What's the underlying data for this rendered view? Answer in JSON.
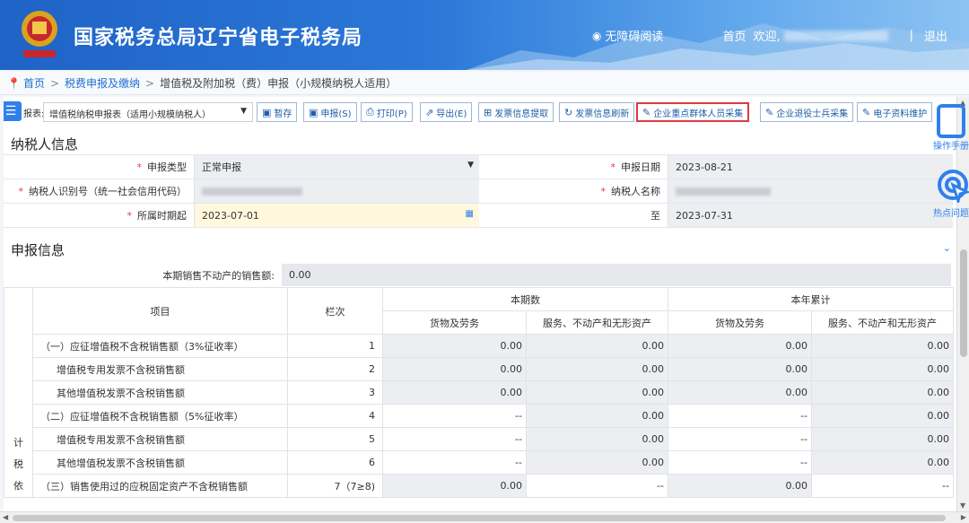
{
  "header": {
    "site_title": "国家税务总局辽宁省电子税务局",
    "accessibility": "无障碍阅读",
    "home": "首页",
    "welcome": "欢迎,",
    "logout": "退出",
    "separator": "|"
  },
  "breadcrumb": {
    "items": [
      "首页",
      "税费申报及缴纳",
      "增值税及附加税（费）申报（小规模纳税人适用）"
    ],
    "arrow": ">"
  },
  "toolbar": {
    "form_label": "报表:",
    "form_select": "增值税纳税申报表（适用小规模纳税人）",
    "buttons": [
      "暂存",
      "申报(S)",
      "打印(P)",
      "导出(E)",
      "发票信息提取",
      "发票信息刷新",
      "企业重点群体人员采集",
      "企业退役士兵采集",
      "电子资料维护"
    ]
  },
  "taxpayer": {
    "title": "纳税人信息",
    "decl_type_label": "申报类型",
    "decl_type_value": "正常申报",
    "decl_date_label": "申报日期",
    "decl_date_value": "2023-08-21",
    "tin_label": "纳税人识别号（统一社会信用代码）",
    "name_label": "纳税人名称",
    "period_label": "所属时期起",
    "period_start": "2023-07-01",
    "period_to_label": "至",
    "period_end": "2023-07-31"
  },
  "declaration": {
    "title": "申报信息",
    "sales_label": "本期销售不动产的销售额:",
    "sales_value": "0.00",
    "headers": {
      "item": "项目",
      "col_no": "栏次",
      "current": "本期数",
      "ytd": "本年累计",
      "goods": "货物及劳务",
      "services": "服务、不动产和无形资产"
    },
    "side_label": [
      "计",
      "税",
      "依"
    ],
    "rows": [
      {
        "item": "（一）应征增值税不含税销售额（3%征收率）",
        "col": "1",
        "c1": "0.00",
        "c2": "0.00",
        "c3": "0.00",
        "c4": "0.00"
      },
      {
        "item": "增值税专用发票不含税销售额",
        "col": "2",
        "c1": "0.00",
        "c2": "0.00",
        "c3": "0.00",
        "c4": "0.00"
      },
      {
        "item": "其他增值税发票不含税销售额",
        "col": "3",
        "c1": "0.00",
        "c2": "0.00",
        "c3": "0.00",
        "c4": "0.00"
      },
      {
        "item": "（二）应征增值税不含税销售额（5%征收率）",
        "col": "4",
        "c1": "--",
        "c2": "0.00",
        "c3": "--",
        "c4": "0.00"
      },
      {
        "item": "增值税专用发票不含税销售额",
        "col": "5",
        "c1": "--",
        "c2": "0.00",
        "c3": "--",
        "c4": "0.00"
      },
      {
        "item": "其他增值税发票不含税销售额",
        "col": "6",
        "c1": "--",
        "c2": "0.00",
        "c3": "--",
        "c4": "0.00"
      },
      {
        "item": "（三）销售使用过的应税固定资产不含税销售额",
        "col": "7（7≥8)",
        "c1": "0.00",
        "c2": "--",
        "c3": "0.00",
        "c4": "--"
      }
    ]
  },
  "float_tools": {
    "manual": "操作手册",
    "faq": "热点问题"
  },
  "colors": {
    "primary": "#2f80ea",
    "header_blue": "#1f63c6",
    "highlight_red": "#e0393e"
  }
}
